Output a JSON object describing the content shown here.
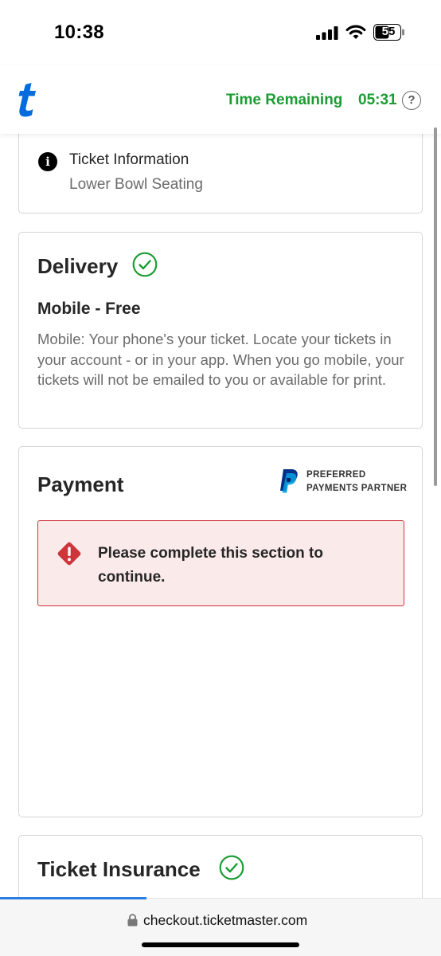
{
  "status_bar": {
    "time": "10:38",
    "battery": "55"
  },
  "header": {
    "logo": "t",
    "timer_label": "Time Remaining",
    "timer_value": "05:31",
    "help": "?"
  },
  "ticket_info": {
    "title": "Ticket Information",
    "subtitle": "Lower Bowl Seating"
  },
  "delivery": {
    "title": "Delivery",
    "method": "Mobile - Free",
    "description": "Mobile: Your phone's your ticket. Locate your tickets in your account - or in your app. When you go mobile, your tickets will not be emailed to you or available for print."
  },
  "payment": {
    "title": "Payment",
    "partner_line1": "PREFERRED",
    "partner_line2": "PAYMENTS PARTNER",
    "alert": "Please complete this section to continue."
  },
  "insurance": {
    "title": "Ticket Insurance"
  },
  "browser": {
    "url": "checkout.ticketmaster.com"
  },
  "colors": {
    "accent_green": "#1a9c33",
    "brand_blue": "#026cdf",
    "error_red": "#d0343b",
    "error_bg": "#fbeaea",
    "paypal_dark": "#003087",
    "paypal_light": "#009cde"
  }
}
